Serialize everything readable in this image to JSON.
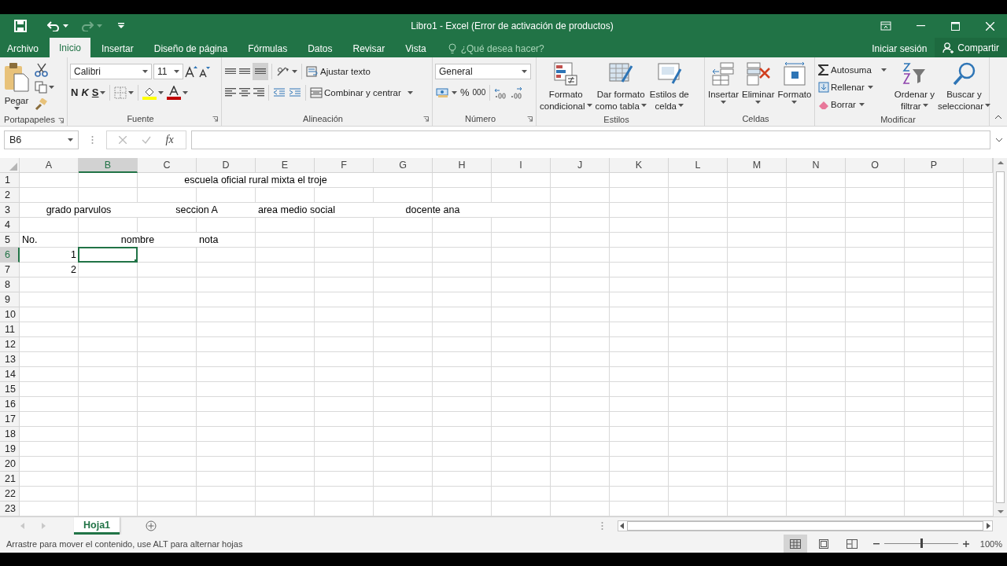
{
  "window": {
    "title": "Libro1 - Excel (Error de activación de productos)"
  },
  "tabs": [
    {
      "label": "Archivo",
      "selected": false
    },
    {
      "label": "Inicio",
      "selected": true
    },
    {
      "label": "Insertar",
      "selected": false
    },
    {
      "label": "Diseño de página",
      "selected": false
    },
    {
      "label": "Fórmulas",
      "selected": false
    },
    {
      "label": "Datos",
      "selected": false
    },
    {
      "label": "Revisar",
      "selected": false
    },
    {
      "label": "Vista",
      "selected": false
    }
  ],
  "tell_me": {
    "placeholder": "¿Qué desea hacer?"
  },
  "account": {
    "sign_in": "Iniciar sesión",
    "share": "Compartir"
  },
  "ribbon": {
    "groups": [
      {
        "label": "Portapapeles",
        "paste": "Pegar"
      },
      {
        "label": "Fuente",
        "font": "Calibri",
        "size": "11",
        "bold": "N",
        "italic": "K",
        "underline": "S"
      },
      {
        "label": "Alineación",
        "wrap": "Ajustar texto",
        "merge": "Combinar y centrar",
        "bottom_align_selected": true
      },
      {
        "label": "Número",
        "format": "General",
        "percent": "%",
        "thousands": "000"
      },
      {
        "label": "Estilos",
        "buttons": [
          [
            "Formato",
            "condicional"
          ],
          [
            "Dar formato",
            "como tabla"
          ],
          [
            "Estilos de",
            "celda"
          ]
        ]
      },
      {
        "label": "Celdas",
        "buttons": [
          [
            "Insertar"
          ],
          [
            "Eliminar"
          ],
          [
            "Formato"
          ]
        ]
      },
      {
        "label": "Modificar",
        "items": [
          "Autosuma",
          "Rellenar",
          "Borrar"
        ],
        "buttons": [
          [
            "Ordenar y",
            "filtrar"
          ],
          [
            "Buscar y",
            "seleccionar"
          ]
        ]
      }
    ]
  },
  "formula_bar": {
    "name_box": "B6",
    "function_label": "fx"
  },
  "grid": {
    "columns": [
      {
        "label": "A",
        "selected": false
      },
      {
        "label": "B",
        "selected": true
      },
      {
        "label": "C",
        "selected": false
      },
      {
        "label": "D",
        "selected": false
      },
      {
        "label": "E",
        "selected": false
      },
      {
        "label": "F",
        "selected": false
      },
      {
        "label": "G",
        "selected": false
      },
      {
        "label": "H",
        "selected": false
      },
      {
        "label": "I",
        "selected": false
      },
      {
        "label": "J",
        "selected": false
      },
      {
        "label": "K",
        "selected": false
      },
      {
        "label": "L",
        "selected": false
      },
      {
        "label": "M",
        "selected": false
      },
      {
        "label": "N",
        "selected": false
      },
      {
        "label": "O",
        "selected": false
      },
      {
        "label": "P",
        "selected": false
      }
    ],
    "rows": [
      {
        "label": "1",
        "selected": false,
        "cells": [
          null,
          null,
          {
            "text": "escuela oficial rural mixta el troje",
            "centered": true,
            "right_aligned": false
          },
          {
            "merged": true
          },
          {
            "merged": true
          },
          {
            "merged": true
          }
        ]
      },
      {
        "label": "2",
        "selected": false
      },
      {
        "label": "3",
        "selected": false,
        "cells": [
          {
            "text": "grado parvulos",
            "centered": true,
            "right_aligned": false
          },
          {
            "merged": true
          },
          {
            "text": "seccion A",
            "centered": true,
            "right_aligned": false
          },
          {
            "merged": true
          },
          {
            "text": "area medio social",
            "centered": false,
            "right_aligned": false
          },
          {
            "merged": true
          },
          {
            "text": "docente ana",
            "centered": true,
            "right_aligned": false
          },
          {
            "merged": true
          }
        ]
      },
      {
        "label": "4",
        "selected": false
      },
      {
        "label": "5",
        "selected": false,
        "cells": [
          {
            "text": "No.",
            "centered": false,
            "right_aligned": false
          },
          {
            "text": "nombre",
            "centered": true,
            "right_aligned": false
          },
          {
            "merged": true
          },
          {
            "text": "nota",
            "centered": false,
            "right_aligned": false
          }
        ]
      },
      {
        "label": "6",
        "selected": true,
        "cells": [
          {
            "text": "1",
            "right_aligned": true
          }
        ]
      },
      {
        "label": "7",
        "selected": false,
        "cells": [
          {
            "text": "2",
            "right_aligned": true
          }
        ]
      },
      {
        "label": "8",
        "selected": false
      },
      {
        "label": "9",
        "selected": false
      },
      {
        "label": "10",
        "selected": false
      },
      {
        "label": "11",
        "selected": false
      },
      {
        "label": "12",
        "selected": false
      },
      {
        "label": "13",
        "selected": false
      },
      {
        "label": "14",
        "selected": false
      },
      {
        "label": "15",
        "selected": false
      },
      {
        "label": "16",
        "selected": false
      },
      {
        "label": "17",
        "selected": false
      },
      {
        "label": "18",
        "selected": false
      },
      {
        "label": "19",
        "selected": false
      },
      {
        "label": "20",
        "selected": false
      },
      {
        "label": "21",
        "selected": false
      },
      {
        "label": "22",
        "selected": false
      },
      {
        "label": "23",
        "selected": false
      }
    ]
  },
  "sheets": [
    {
      "label": "Hoja1",
      "selected": true
    }
  ],
  "status_bar": {
    "message": "Arrastre para mover el contenido, use ALT para alternar hojas",
    "views": [
      {
        "selected": true
      },
      {
        "selected": false
      },
      {
        "selected": false
      }
    ],
    "zoom": {
      "level": 0.5,
      "reading": "100%"
    }
  }
}
